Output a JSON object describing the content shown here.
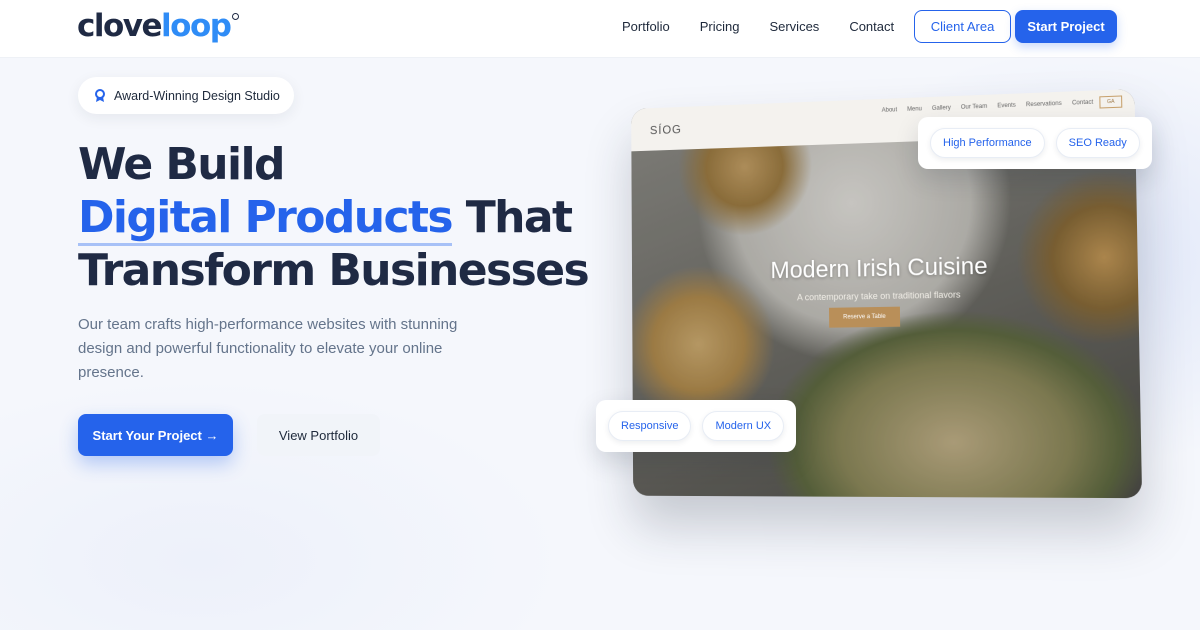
{
  "brand": {
    "logo_part1": "clove",
    "logo_part2": "loop"
  },
  "nav": {
    "links": [
      "Portfolio",
      "Pricing",
      "Services",
      "Contact"
    ],
    "client_area": "Client Area",
    "start_project": "Start Project"
  },
  "hero": {
    "badge": "Award-Winning Design Studio",
    "headline_line1": "We Build",
    "headline_accent": "Digital Products",
    "headline_line2_rest": " That",
    "headline_line3": "Transform Businesses",
    "lede": "Our team crafts high-performance websites with stunning design and powerful functionality to elevate your online presence.",
    "cta_primary": "Start Your Project →",
    "cta_secondary": "View Portfolio"
  },
  "mockup": {
    "logo": "SÍOG",
    "links": [
      "About",
      "Menu",
      "Gallery",
      "Our Team",
      "Events",
      "Reservations",
      "Contact"
    ],
    "lang": "GA",
    "title": "Modern Irish Cuisine",
    "subtitle": "A contemporary take on traditional flavors",
    "button": "Reserve a Table"
  },
  "feature_pills": {
    "top": [
      "High Performance",
      "SEO Ready"
    ],
    "bottom": [
      "Responsive",
      "Modern UX"
    ]
  },
  "colors": {
    "primary": "#2563eb",
    "logo_accent": "#2f8cf6",
    "heading": "#1f2a44",
    "muted": "#64748b"
  }
}
